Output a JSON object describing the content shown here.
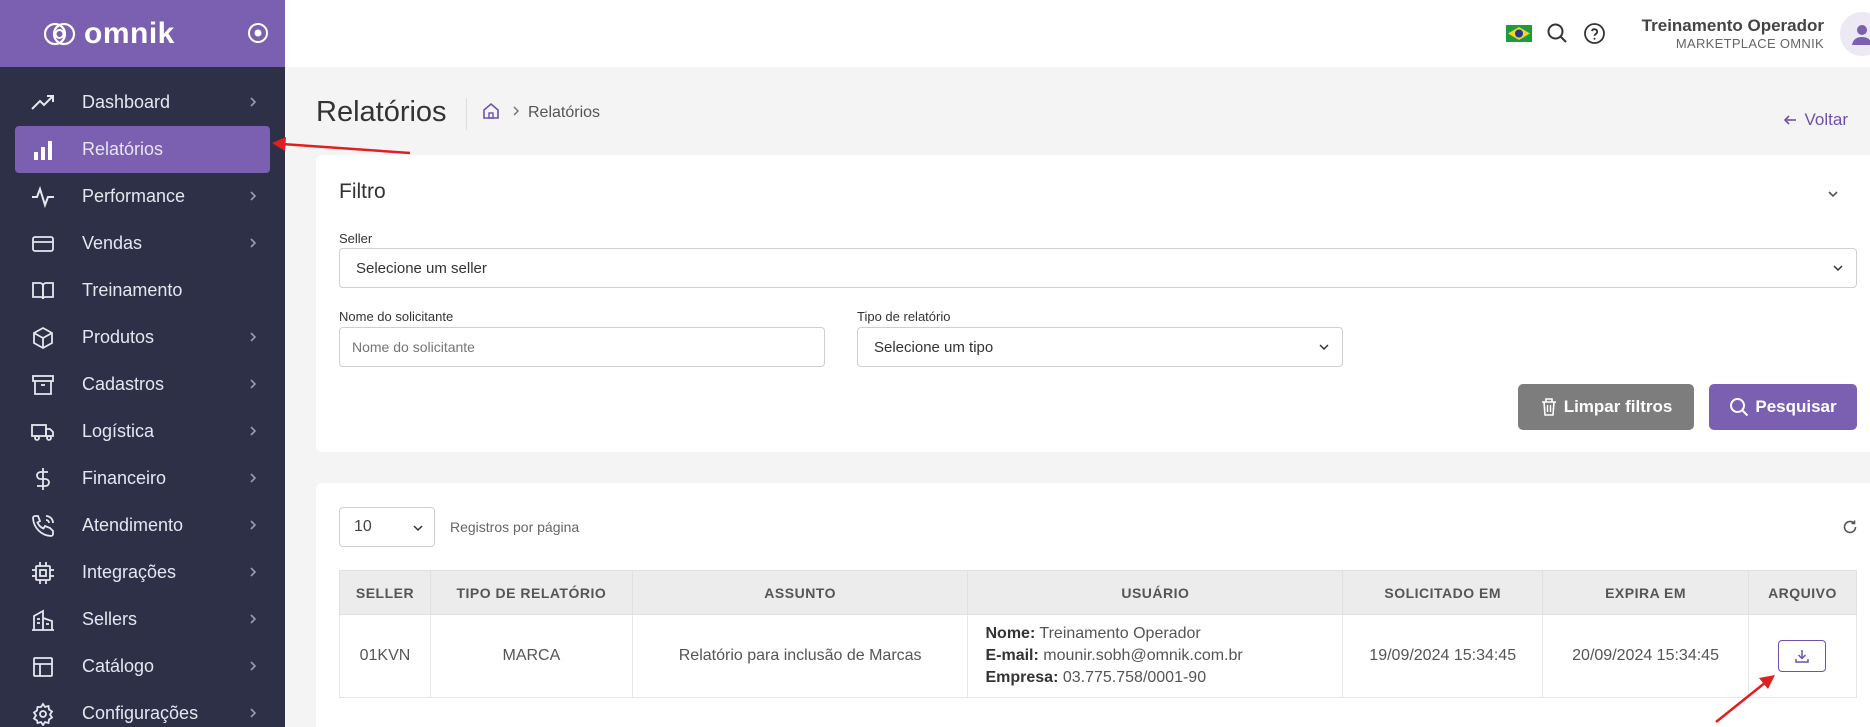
{
  "brand": {
    "name": "omnik"
  },
  "sidebar": {
    "items": [
      {
        "label": "Dashboard",
        "icon": "trending-up-icon",
        "has_chevron": true,
        "active": false
      },
      {
        "label": "Relatórios",
        "icon": "bar-chart-icon",
        "has_chevron": false,
        "active": true
      },
      {
        "label": "Performance",
        "icon": "activity-icon",
        "has_chevron": true,
        "active": false
      },
      {
        "label": "Vendas",
        "icon": "credit-card-icon",
        "has_chevron": true,
        "active": false
      },
      {
        "label": "Treinamento",
        "icon": "book-open-icon",
        "has_chevron": false,
        "active": false
      },
      {
        "label": "Produtos",
        "icon": "box-icon",
        "has_chevron": true,
        "active": false
      },
      {
        "label": "Cadastros",
        "icon": "archive-icon",
        "has_chevron": true,
        "active": false
      },
      {
        "label": "Logística",
        "icon": "truck-icon",
        "has_chevron": true,
        "active": false
      },
      {
        "label": "Financeiro",
        "icon": "dollar-icon",
        "has_chevron": true,
        "active": false
      },
      {
        "label": "Atendimento",
        "icon": "phone-icon",
        "has_chevron": true,
        "active": false
      },
      {
        "label": "Integrações",
        "icon": "cpu-icon",
        "has_chevron": true,
        "active": false
      },
      {
        "label": "Sellers",
        "icon": "building-icon",
        "has_chevron": true,
        "active": false
      },
      {
        "label": "Catálogo",
        "icon": "layout-icon",
        "has_chevron": true,
        "active": false
      },
      {
        "label": "Configurações",
        "icon": "settings-icon",
        "has_chevron": true,
        "active": false
      }
    ]
  },
  "topbar": {
    "user_name": "Treinamento Operador",
    "user_sub": "MARKETPLACE OMNIK"
  },
  "page": {
    "title": "Relatórios",
    "breadcrumb_current": "Relatórios",
    "back_label": "Voltar"
  },
  "filter": {
    "title": "Filtro",
    "seller_label": "Seller",
    "seller_value": "Selecione um seller",
    "requester_label": "Nome do solicitante",
    "requester_placeholder": "Nome do solicitante",
    "type_label": "Tipo de relatório",
    "type_value": "Selecione um tipo",
    "clear_label": "Limpar filtros",
    "search_label": "Pesquisar"
  },
  "results": {
    "per_page_value": "10",
    "per_page_label": "Registros por página",
    "columns": [
      "SELLER",
      "TIPO DE RELATÓRIO",
      "ASSUNTO",
      "USUÁRIO",
      "SOLICITADO EM",
      "EXPIRA EM",
      "ARQUIVO"
    ],
    "rows": [
      {
        "seller": "01KVN",
        "type": "MARCA",
        "subject": "Relatório para inclusão de Marcas",
        "user_name_label": "Nome:",
        "user_name": "Treinamento Operador",
        "user_email_label": "E-mail:",
        "user_email": "mounir.sobh@omnik.com.br",
        "user_company_label": "Empresa:",
        "user_company": "03.775.758/0001-90",
        "requested_at": "19/09/2024 15:34:45",
        "expires_at": "20/09/2024 15:34:45"
      }
    ]
  },
  "colors": {
    "sidebar_bg": "#2d3047",
    "brand_purple": "#7b5fb0",
    "clear_btn": "#7d7d7d",
    "annotation_red": "#e02020"
  }
}
